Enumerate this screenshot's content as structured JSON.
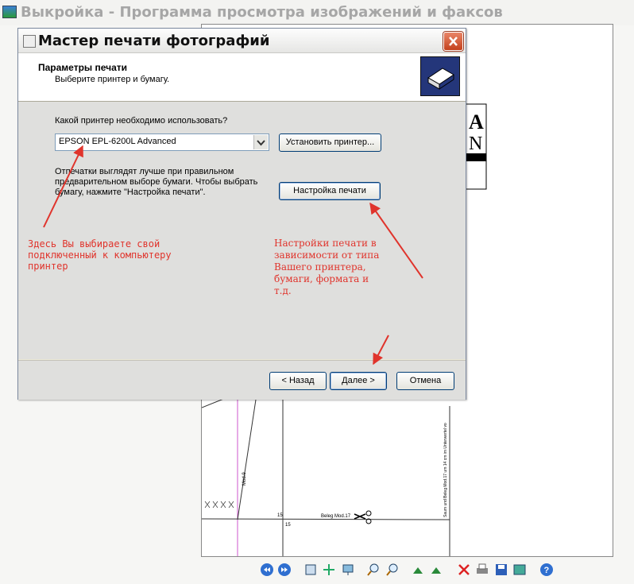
{
  "window": {
    "title": "Выкройка - Программа просмотра изображений и факсов"
  },
  "dialog": {
    "title": "Мастер печати фотографий",
    "header_title": "Параметры печати",
    "header_subtitle": "Выберите принтер и бумагу.",
    "printer_question": "Какой принтер необходимо использовать?",
    "printer_value": "EPSON EPL-6200L Advanced",
    "install_button": "Установить принтер...",
    "hint_lines": [
      "Отпечатки выглядят лучше при правильном",
      "предварительном выборе бумаги. Чтобы выбрать",
      "бумагу, нажмите \"Настройка печати\"."
    ],
    "settings_button": "Настройка печати",
    "back_button": "< Назад",
    "next_button": "Далее >",
    "cancel_button": "Отмена"
  },
  "annotations": {
    "left_note": [
      "Здесь Вы выбираете свой",
      "подключенный к компьютеру",
      "принтер"
    ],
    "right_note": [
      "Настройки печати в",
      "зависимости от типа",
      "Вашего принтера,",
      "бумаги, формата и",
      "т.д."
    ],
    "color": "#e0342c"
  },
  "document": {
    "text_a": "A",
    "text_n": "N",
    "beleg": "Beleg Mod.17",
    "mod": "Mod.9",
    "n15a": "15",
    "n15b": "15",
    "side": "Saum und Beleg Mod.17 um 14 cm im Unterwertel vo"
  },
  "toolbar": {
    "icons": [
      "prev-image-icon",
      "next-image-icon",
      "best-fit-icon",
      "actual-size-icon",
      "slideshow-icon",
      "zoom-in-icon",
      "zoom-out-icon",
      "rotate-clockwise-icon",
      "rotate-counterclockwise-icon",
      "delete-icon",
      "print-icon",
      "save-icon",
      "edit-icon",
      "help-icon"
    ]
  }
}
